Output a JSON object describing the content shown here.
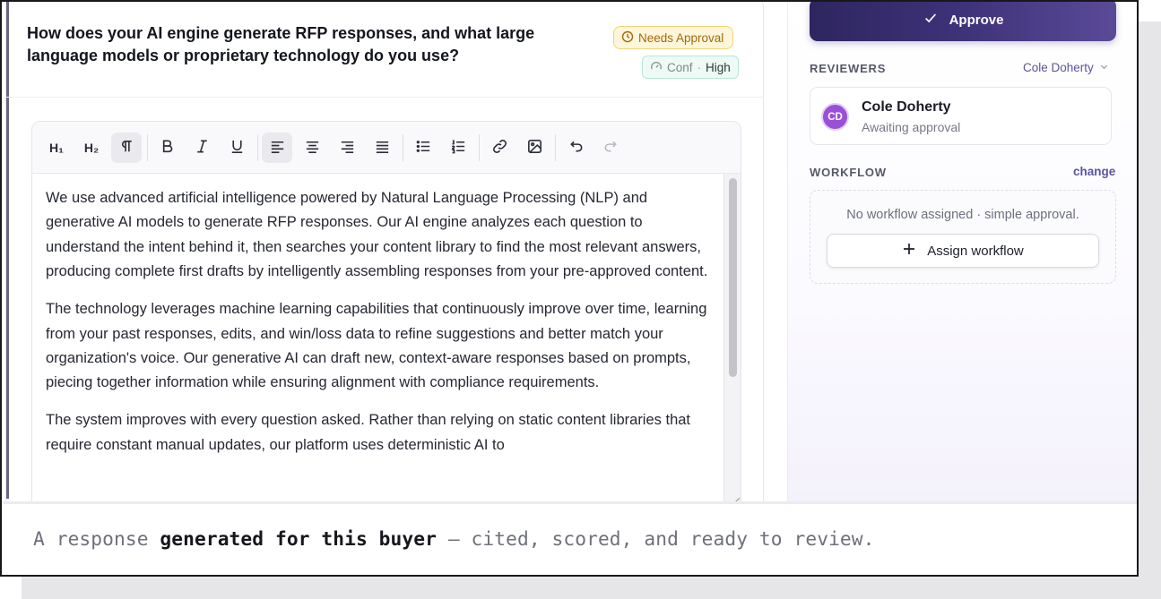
{
  "question": {
    "title": "How does your AI engine generate RFP responses, and what large language models or proprietary technology do you use?",
    "status_badge": "Needs Approval",
    "confidence_label": "Conf",
    "confidence_separator": "·",
    "confidence_value": "High"
  },
  "toolbar": {
    "h1_label": "H₁",
    "h2_label": "H₂",
    "icons": [
      "h1-icon",
      "h2-icon",
      "paragraph-icon",
      "bold-icon",
      "italic-icon",
      "underline-icon",
      "align-left-icon",
      "align-center-icon",
      "align-right-icon",
      "align-justify-icon",
      "bullet-list-icon",
      "numbered-list-icon",
      "link-icon",
      "image-icon",
      "undo-icon",
      "redo-icon"
    ]
  },
  "editor": {
    "paragraphs": [
      "We use advanced artificial intelligence powered by Natural Language Processing (NLP) and generative AI models to generate RFP responses. Our AI engine analyzes each question to understand the intent behind it, then searches your content library to find the most relevant answers, producing complete first drafts by intelligently assembling responses from your pre-approved content.",
      "The technology leverages machine learning capabilities that continuously improve over time, learning from your past responses, edits, and win/loss data to refine suggestions and better match your organization's voice. Our generative AI can draft new, context-aware responses based on prompts, piecing together information while ensuring alignment with compliance requirements.",
      "The system improves with every question asked. Rather than relying on static content libraries that require constant manual updates, our platform uses deterministic AI to"
    ]
  },
  "sidebar": {
    "approve_label": "Approve",
    "reviewers_label": "REVIEWERS",
    "reviewer_select": "Cole Doherty",
    "reviewer": {
      "initials": "CD",
      "name": "Cole Doherty",
      "status": "Awaiting approval"
    },
    "workflow_label": "WORKFLOW",
    "workflow_change": "change",
    "workflow_empty": "No workflow assigned · simple approval.",
    "assign_label": "Assign workflow"
  },
  "caption": {
    "prefix": "A response ",
    "emphasis": "generated for this buyer",
    "suffix": " — cited, scored, and ready to review."
  },
  "colors": {
    "accent": "#3e3279",
    "approval_badge": "#fdf6dc",
    "confidence_badge": "#edfaf5",
    "avatar": "#9a4fd9"
  }
}
